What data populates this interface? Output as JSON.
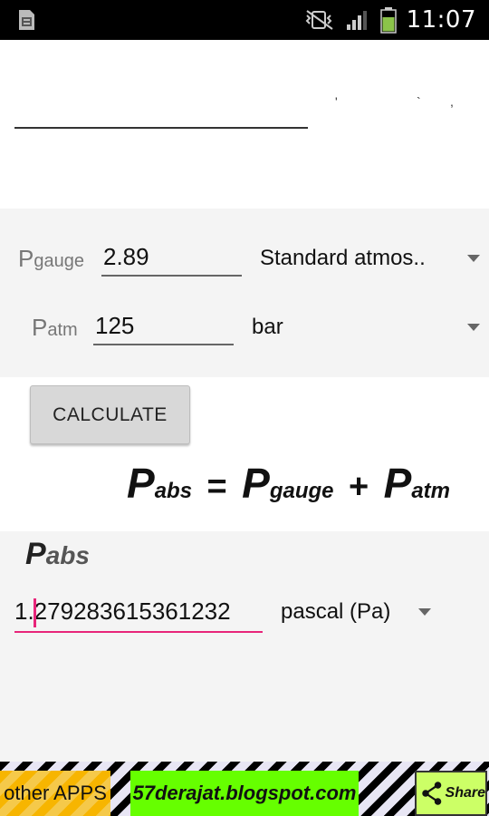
{
  "status_bar": {
    "time": "11:07"
  },
  "inputs": {
    "gauge": {
      "label_main": "P",
      "label_sub": "gauge",
      "value": "2.89",
      "unit": "Standard atmos.."
    },
    "atm": {
      "label_main": "P",
      "label_sub": "atm",
      "value": "125",
      "unit": "bar"
    }
  },
  "calculate_label": "CALCULATE",
  "formula": {
    "lhs_main": "P",
    "lhs_sub": "abs",
    "equals": "=",
    "term1_main": "P",
    "term1_sub": "gauge",
    "plus": "+",
    "term2_main": "P",
    "term2_sub": "atm"
  },
  "result": {
    "title_main": "P",
    "title_sub": "abs",
    "value": "1.279283615361232",
    "unit": "pascal (Pa)"
  },
  "footer": {
    "other_apps": "other APPS",
    "blog": "57derajat.blogspot.com",
    "share": "Share"
  },
  "colors": {
    "accent": "#e8257a",
    "blog_bg": "#66ff00",
    "share_bg": "#ccff66",
    "other_bg": "#f7b500"
  }
}
